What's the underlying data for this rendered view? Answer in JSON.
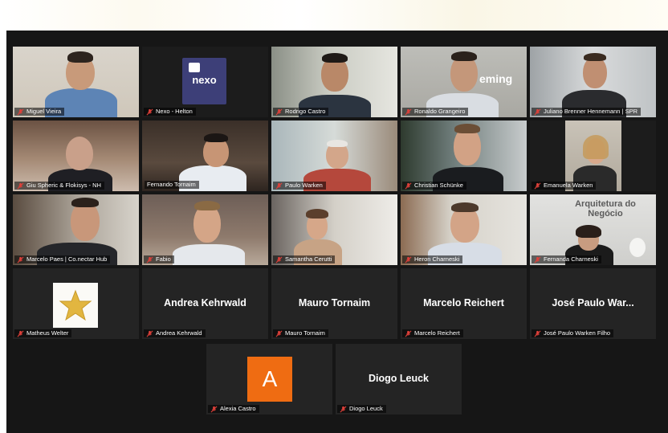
{
  "participants": [
    {
      "name": "Miguel Vieira",
      "type": "video"
    },
    {
      "name": "Nexo - Helton",
      "type": "logo",
      "logo_text": "nexo"
    },
    {
      "name": "Rodrigo Castro",
      "type": "video"
    },
    {
      "name": "Ronaldo Grangeiro",
      "type": "video",
      "wall_text": "eming"
    },
    {
      "name": "Juliano Brenner Hennemann | SPR",
      "type": "video"
    },
    {
      "name": "Giu Spheric & Flokisys - NH",
      "type": "video"
    },
    {
      "name": "Fernando Tornaim",
      "type": "video",
      "active_speaker": true
    },
    {
      "name": "Paulo Warken",
      "type": "video"
    },
    {
      "name": "Christian Schünke",
      "type": "video"
    },
    {
      "name": "Emanuela Warken",
      "type": "video"
    },
    {
      "name": "Marcelo Paes | Co.nectar Hub",
      "type": "video"
    },
    {
      "name": "Fabio",
      "type": "video"
    },
    {
      "name": "Samantha Cerutti",
      "type": "video"
    },
    {
      "name": "Heron Charneski",
      "type": "video"
    },
    {
      "name": "Fernanda Charneski",
      "type": "video",
      "wall_text": "Arquitetura do Negócio"
    },
    {
      "name": "Matheus Welter",
      "type": "star-avatar"
    },
    {
      "name": "Andrea Kehrwald",
      "type": "name",
      "display": "Andrea Kehrwald"
    },
    {
      "name": "Mauro Tornaim",
      "type": "name",
      "display": "Mauro Tornaim"
    },
    {
      "name": "Marcelo Reichert",
      "type": "name",
      "display": "Marcelo Reichert"
    },
    {
      "name": "José Paulo Warken Filho",
      "type": "name",
      "display": "José Paulo War..."
    },
    {
      "name": "Alexia Castro",
      "type": "letter-avatar",
      "letter": "A"
    },
    {
      "name": "Diogo Leuck",
      "type": "name",
      "display": "Diogo Leuck"
    }
  ],
  "colors": {
    "active_border": "#c8e04a",
    "muted_mic": "#e0403a",
    "avatar_orange": "#ef6c12"
  },
  "icons": {
    "mic": "muted-microphone-icon"
  }
}
